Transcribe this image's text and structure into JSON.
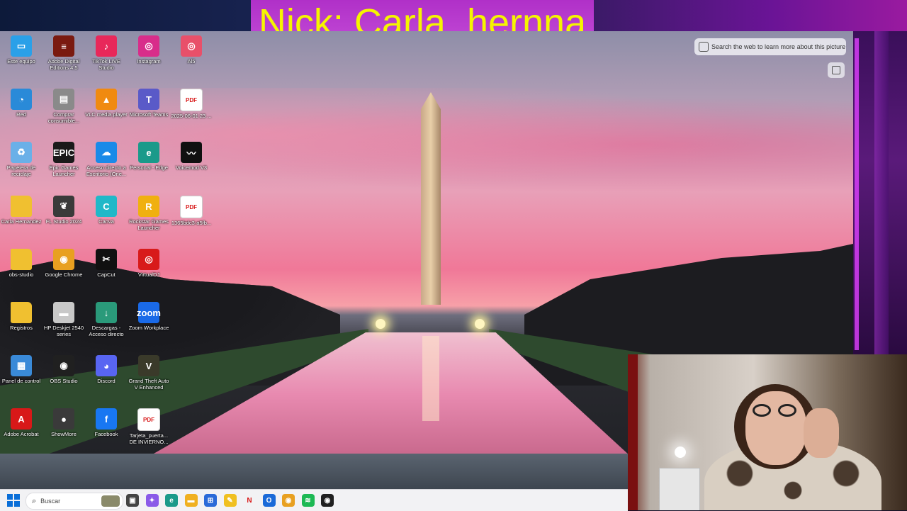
{
  "stream": {
    "nick_text": "Nick: Carla_hernna"
  },
  "lens": {
    "search_label": "Search the web to learn more about this picture"
  },
  "desktop_icons": [
    {
      "label": "Este equipo",
      "icon": "computer-icon",
      "color": "#2aa0e8",
      "glyph": "▭"
    },
    {
      "label": "Adobe Digital Editions 4.5",
      "icon": "adobe-digital-editions-icon",
      "color": "#7a1a10",
      "glyph": "≡"
    },
    {
      "label": "TikTok LIVE Studio",
      "icon": "tiktok-icon",
      "color": "#e8285a",
      "glyph": "♪"
    },
    {
      "label": "Instagram",
      "icon": "instagram-icon",
      "color": "#d82d8a",
      "glyph": "◎"
    },
    {
      "label": "Al5",
      "icon": "instagram-alt-icon",
      "color": "#e8506a",
      "glyph": "◎"
    },
    {
      "label": "Red",
      "icon": "network-icon",
      "color": "#2a8ad8",
      "glyph": "◔"
    },
    {
      "label": "Comprar consumible...",
      "icon": "printer-shop-icon",
      "color": "#8a8a8a",
      "glyph": "▤"
    },
    {
      "label": "VLC media player",
      "icon": "vlc-icon",
      "color": "#f08a10",
      "glyph": "▲"
    },
    {
      "label": "Microsoft Teams",
      "icon": "teams-icon",
      "color": "#5a5ac8",
      "glyph": "T"
    },
    {
      "label": "2025-06-01 23 ...",
      "icon": "pdf-icon",
      "color": "#d81818",
      "glyph": "PDF"
    },
    {
      "label": "Papelera de reciclaje",
      "icon": "recycle-bin-icon",
      "color": "#6ab0e8",
      "glyph": "♻"
    },
    {
      "label": "Epic Games Launcher",
      "icon": "epic-games-icon",
      "color": "#1a1a1a",
      "glyph": "EPIC"
    },
    {
      "label": "Acceso directo a Escritorio (One...",
      "icon": "onedrive-icon",
      "color": "#1a8ae8",
      "glyph": "☁"
    },
    {
      "label": "Personal - Edge",
      "icon": "edge-icon",
      "color": "#1a9a8a",
      "glyph": "e"
    },
    {
      "label": "Voicemod V3",
      "icon": "voicemod-icon",
      "color": "#101010",
      "glyph": "〰"
    },
    {
      "label": "Carla Hernandez",
      "icon": "folder-icon",
      "color": "#f0c030",
      "glyph": ""
    },
    {
      "label": "FL Studio 2024",
      "icon": "fl-studio-icon",
      "color": "#3a3a3a",
      "glyph": "❦"
    },
    {
      "label": "Canva",
      "icon": "canva-icon",
      "color": "#20b8c8",
      "glyph": "C"
    },
    {
      "label": "Rockstar Games Launcher",
      "icon": "rockstar-icon",
      "color": "#f0b010",
      "glyph": "R"
    },
    {
      "label": "1365bdc3-a5fb...",
      "icon": "pdf-icon",
      "color": "#d81818",
      "glyph": "PDF"
    },
    {
      "label": "obs-studio",
      "icon": "folder-icon",
      "color": "#f0c030",
      "glyph": ""
    },
    {
      "label": "Google Chrome",
      "icon": "chrome-icon",
      "color": "#e8a020",
      "glyph": "◉"
    },
    {
      "label": "CapCut",
      "icon": "capcut-icon",
      "color": "#111111",
      "glyph": "✂"
    },
    {
      "label": "VirtualDJ",
      "icon": "virtualdj-icon",
      "color": "#d81a1a",
      "glyph": "◎"
    },
    {
      "label": "Registros",
      "icon": "folder-icon",
      "color": "#f0c030",
      "glyph": ""
    },
    {
      "label": "HP Deskjet 2540 series",
      "icon": "printer-icon",
      "color": "#c8c8c8",
      "glyph": "▬"
    },
    {
      "label": "Descargas - Acceso directo",
      "icon": "downloads-icon",
      "color": "#2a9a7a",
      "glyph": "↓"
    },
    {
      "label": "Zoom Workplace",
      "icon": "zoom-icon",
      "color": "#1a6ae8",
      "glyph": "zoom"
    },
    {
      "label": "Panel de control",
      "icon": "control-panel-icon",
      "color": "#3a8ad8",
      "glyph": "▦"
    },
    {
      "label": "OBS Studio",
      "icon": "obs-icon",
      "color": "#202020",
      "glyph": "◉"
    },
    {
      "label": "Discord",
      "icon": "discord-icon",
      "color": "#5865f2",
      "glyph": "◕"
    },
    {
      "label": "Grand Theft Auto V Enhanced",
      "icon": "gta-icon",
      "color": "#3a3a2a",
      "glyph": "V"
    },
    {
      "label": "Adobe Acrobat",
      "icon": "acrobat-icon",
      "color": "#d81818",
      "glyph": "A"
    },
    {
      "label": "ShowMore",
      "icon": "showmore-icon",
      "color": "#3a3a3a",
      "glyph": "●"
    },
    {
      "label": "Facebook",
      "icon": "facebook-icon",
      "color": "#1877f2",
      "glyph": "f"
    },
    {
      "label": "Tarjeta_puerta... DE INVIERNO...",
      "icon": "pdf-icon",
      "color": "#d81818",
      "glyph": "PDF"
    }
  ],
  "taskbar": {
    "search_placeholder": "Buscar",
    "apps": [
      {
        "icon": "task-view-icon",
        "color": "#444444",
        "glyph": "▣"
      },
      {
        "icon": "copilot-icon",
        "color": "#8a5ae8",
        "glyph": "✦"
      },
      {
        "icon": "edge-icon",
        "color": "#1a9a8a",
        "glyph": "e"
      },
      {
        "icon": "file-explorer-icon",
        "color": "#f0b020",
        "glyph": "▬"
      },
      {
        "icon": "microsoft-store-icon",
        "color": "#2a6ad8",
        "glyph": "⊞"
      },
      {
        "icon": "sticky-app-icon",
        "color": "#f0c020",
        "glyph": "✎"
      },
      {
        "icon": "netflix-icon",
        "color": "#ffffff",
        "glyph": "N"
      },
      {
        "icon": "outlook-icon",
        "color": "#1a6ad8",
        "glyph": "O"
      },
      {
        "icon": "chrome-icon",
        "color": "#e8a020",
        "glyph": "◉"
      },
      {
        "icon": "spotify-icon",
        "color": "#1db954",
        "glyph": "≋"
      },
      {
        "icon": "obs-icon",
        "color": "#202020",
        "glyph": "◉"
      }
    ]
  }
}
